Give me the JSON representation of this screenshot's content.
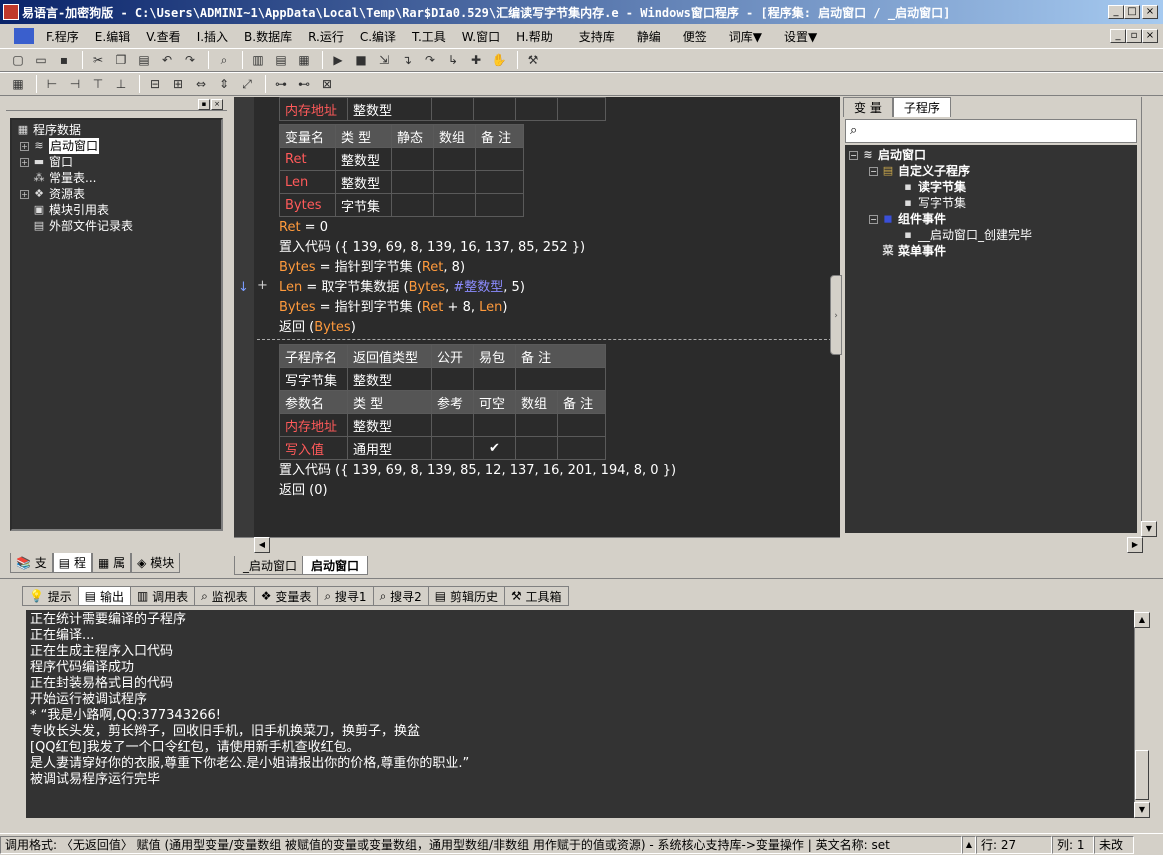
{
  "window": {
    "title": "易语言-加密狗版 - C:\\Users\\ADMINI~1\\AppData\\Local\\Temp\\Rar$DIa0.529\\汇编读写字节集内存.e - Windows窗口程序 - [程序集: 启动窗口 / _启动窗口]"
  },
  "menu": [
    "F.程序",
    "E.编辑",
    "V.查看",
    "I.插入",
    "B.数据库",
    "R.运行",
    "C.编译",
    "T.工具",
    "W.窗口",
    "H.帮助",
    "支持库",
    "静编",
    "便签",
    "词库▼",
    "设置▼"
  ],
  "left_tree": {
    "items": [
      {
        "label": "程序数据",
        "icon": "data-icon"
      },
      {
        "label": "启动窗口",
        "icon": "stack-icon"
      },
      {
        "label": "窗口",
        "icon": "window-icon"
      },
      {
        "label": "常量表...",
        "icon": "constant-icon"
      },
      {
        "label": "资源表",
        "icon": "resource-icon"
      },
      {
        "label": "模块引用表",
        "icon": "module-icon"
      },
      {
        "label": "外部文件记录表",
        "icon": "file-icon"
      }
    ],
    "tabs": [
      "支",
      "程",
      "属",
      "模块"
    ]
  },
  "code": {
    "top_row": {
      "name": "内存地址",
      "type": "整数型"
    },
    "var_table": {
      "headers": [
        "变量名",
        "类 型",
        "静态",
        "数组",
        "备 注"
      ],
      "rows": [
        [
          "Ret",
          "整数型"
        ],
        [
          "Len",
          "整数型"
        ],
        [
          "Bytes",
          "字节集"
        ]
      ]
    },
    "lines1": [
      {
        "a": "Ret",
        "b": " = 0"
      },
      {
        "a": "",
        "b": "置入代码 ({ 139, 69, 8, 139, 16, 137, 85, 252 })"
      },
      {
        "a": "Bytes",
        "b": " = 指针到字节集 (",
        "c": "Ret",
        "d": ", 8)"
      },
      {
        "a": "Len",
        "b": " = 取字节集数据 (",
        "c": "Bytes",
        "d": ", ",
        "e": "#整数型",
        "f": ", 5)"
      },
      {
        "a": "Bytes",
        "b": " = 指针到字节集 (",
        "c": "Ret",
        "d": " + 8, ",
        "e2": "Len",
        "f": ")"
      },
      {
        "a": "",
        "b": "返回 (",
        "c": "Bytes",
        "d": ")"
      }
    ],
    "markers": {
      "arrow": "↓",
      "plus": "+"
    },
    "sub_table": {
      "headers": [
        "子程序名",
        "返回值类型",
        "公开",
        "易包",
        "备 注"
      ],
      "row": [
        "写字节集",
        "整数型"
      ],
      "param_headers": [
        "参数名",
        "类 型",
        "参考",
        "可空",
        "数组",
        "备 注"
      ],
      "params": [
        [
          "内存地址",
          "整数型",
          "",
          "",
          ""
        ],
        [
          "写入值",
          "通用型",
          "",
          "✔",
          ""
        ]
      ]
    },
    "lines2": [
      "置入代码 ({ 139, 69, 8, 139, 85, 12, 137, 16, 201, 194, 8, 0 })",
      "返回 (0)"
    ]
  },
  "code_tabs": [
    "_启动窗口",
    "启动窗口"
  ],
  "right_panel": {
    "tabs": [
      "变 量",
      "子程序"
    ],
    "tree": [
      {
        "label": "启动窗口",
        "level": 0,
        "bold": true
      },
      {
        "label": "自定义子程序",
        "level": 1,
        "bold": true
      },
      {
        "label": "读字节集",
        "level": 2,
        "bold": true
      },
      {
        "label": "写字节集",
        "level": 2,
        "bold": false
      },
      {
        "label": "组件事件",
        "level": 1,
        "bold": true
      },
      {
        "label": "__启动窗口_创建完毕",
        "level": 2,
        "bold": false
      },
      {
        "label": "菜单事件",
        "level": 1,
        "bold": true
      }
    ]
  },
  "output_tabs": [
    "提示",
    "输出",
    "调用表",
    "监视表",
    "变量表",
    "搜寻1",
    "搜寻2",
    "剪辑历史",
    "工具箱"
  ],
  "output_lines": [
    "正在统计需要编译的子程序",
    "正在编译...",
    "正在生成主程序入口代码",
    "程序代码编译成功",
    "正在封装易格式目的代码",
    "开始运行被调试程序",
    "* “我是小路啊,QQ:377343266!",
    "专收长头发，剪长辫子，回收旧手机，旧手机换菜刀，换剪子，换盆",
    "[QQ红包]我发了一个口令红包，请使用新手机查收红包。",
    "是人妻请穿好你的衣服,尊重下你老公.是小姐请报出你的价格,尊重你的职业.”",
    "被调试易程序运行完毕"
  ],
  "status": {
    "text": "调用格式: 〈无返回值〉 赋值 (通用型变量/变量数组 被赋值的变量或变量数组，通用型数组/非数组 用作赋于的值或资源) - 系统核心支持库->变量操作  |  英文名称: set",
    "row": "行: 27",
    "col": "列: 1",
    "mode": "未改"
  },
  "colors": {
    "editor_bg": "#2b2b2b",
    "title_start": "#0a246a",
    "title_end": "#a6caf0"
  }
}
